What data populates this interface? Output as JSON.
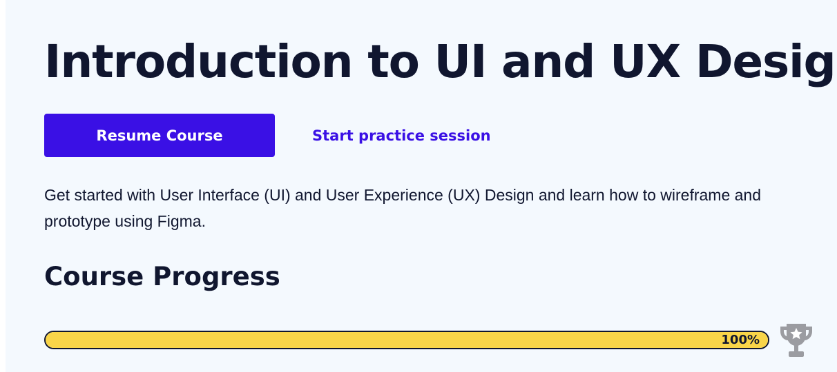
{
  "course": {
    "title": "Introduction to UI and UX Design",
    "resume_label": "Resume Course",
    "practice_label": "Start practice session",
    "description": "Get started with User Interface (UI) and User Experience (UX) Design and learn how to wireframe and prototype using Figma."
  },
  "progress": {
    "heading": "Course Progress",
    "percent": 100,
    "percent_label": "100%",
    "bar_color": "#f9d549",
    "icon": "trophy-icon"
  },
  "colors": {
    "primary": "#3a10e5",
    "text": "#10162f",
    "background": "#f4f9fe",
    "trophy": "#9b9ca1"
  }
}
